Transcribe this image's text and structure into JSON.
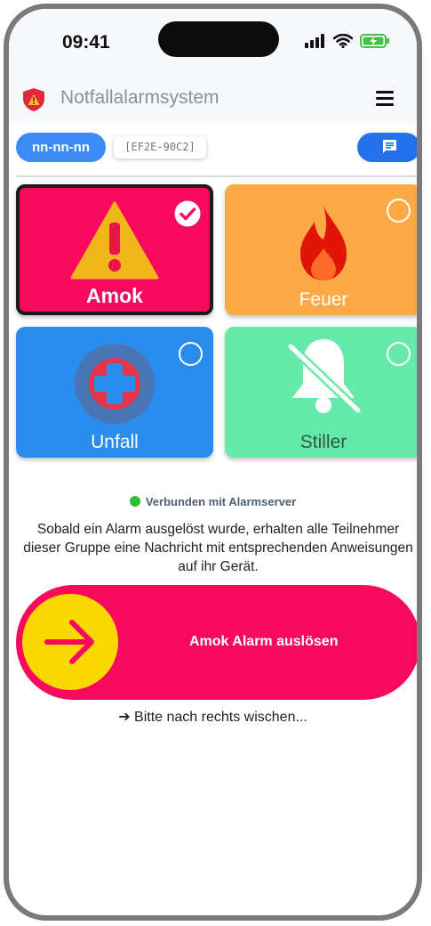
{
  "status_bar": {
    "time": "09:41"
  },
  "app_bar": {
    "title": "Notfallalarmsystem"
  },
  "top_row": {
    "group_chip": "nn-nn-nn",
    "device_id": "[EF2E-90C2]"
  },
  "alarm_types": [
    {
      "label": "Amok",
      "selected": true,
      "color": "#f70a5e"
    },
    {
      "label": "Feuer",
      "selected": false,
      "color": "#fbaa45"
    },
    {
      "label": "Unfall",
      "selected": false,
      "color": "#2a8ded"
    },
    {
      "label": "Stiller",
      "selected": false,
      "color": "#66eaa9"
    }
  ],
  "connection": {
    "status": "Verbunden mit Alarmserver",
    "color": "#2fbf2f"
  },
  "info_text": "Sobald ein Alarm ausgelöst wurde, erhalten alle Teilnehmer dieser Gruppe eine Nachricht mit entsprechenden Anweisungen auf ihr Gerät.",
  "slider": {
    "label": "Amok Alarm auslösen",
    "hint": "➔ Bitte nach rechts wischen..."
  }
}
